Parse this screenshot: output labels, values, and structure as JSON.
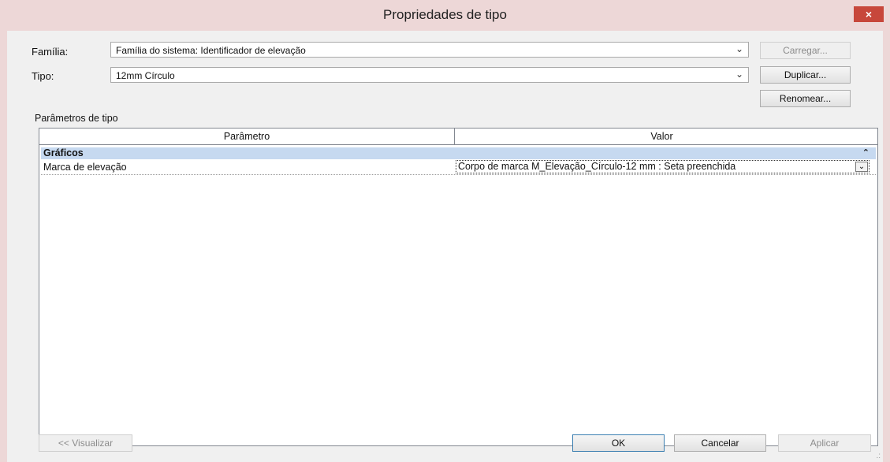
{
  "window": {
    "title": "Propriedades de tipo",
    "close_label": "×"
  },
  "family": {
    "label": "Família:",
    "value": "Família do sistema: Identificador de elevação",
    "load_button": "Carregar..."
  },
  "type": {
    "label": "Tipo:",
    "value": "12mm Círculo",
    "duplicate_button": "Duplicar...",
    "rename_button": "Renomear..."
  },
  "params": {
    "section_label": "Parâmetros de tipo",
    "columns": [
      "Parâmetro",
      "Valor"
    ],
    "groups": [
      {
        "name": "Gráficos",
        "collapse_icon": "⌃",
        "rows": [
          {
            "name": "Marca de elevação",
            "value": "Corpo de marca M_Elevação_Círculo-12 mm : Seta preenchida"
          }
        ]
      }
    ]
  },
  "footer": {
    "preview_button": "<< Visualizar",
    "ok_button": "OK",
    "cancel_button": "Cancelar",
    "apply_button": "Aplicar"
  },
  "colors": {
    "title_bar": "#edd7d7",
    "close_button": "#c7473b",
    "group_header": "#c6d9f0",
    "dialog_bg": "#f0f0f0"
  }
}
